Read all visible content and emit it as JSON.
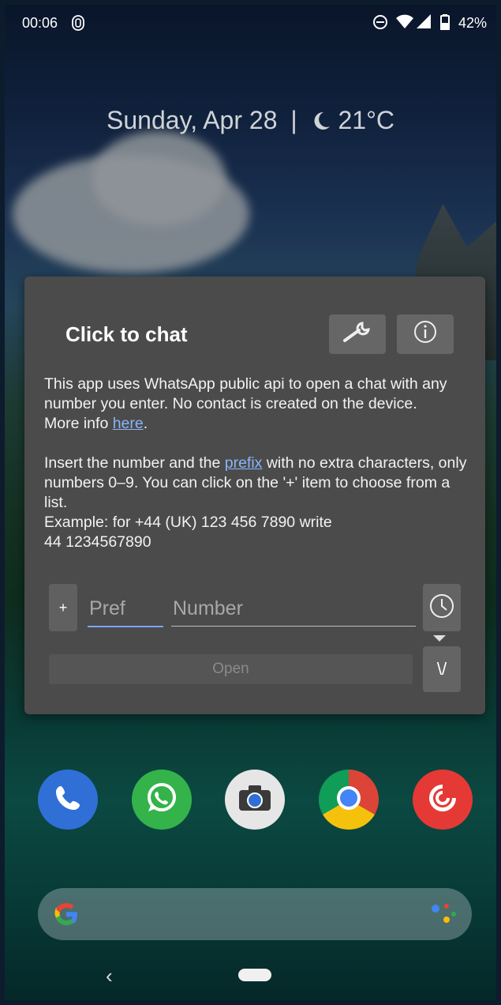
{
  "statusbar": {
    "time": "00:06",
    "battery": "42%",
    "icons": [
      "fingerprint-icon",
      "dnd-icon",
      "wifi-icon",
      "signal-icon",
      "battery-icon"
    ]
  },
  "glance": {
    "date": "Sunday, Apr 28",
    "separator": "|",
    "temperature": "21°C",
    "weather_icon": "moon-icon"
  },
  "dialog": {
    "title": "Click to chat",
    "settings_icon": "wrench-icon",
    "info_icon": "info-icon",
    "description_1": "This app uses WhatsApp public api to open a chat with any number you enter. No contact is created on the device.",
    "more_info_prefix": "More info ",
    "more_info_link": "here",
    "more_info_suffix": ".",
    "instructions_1": "Insert the number and the ",
    "prefix_link": "prefix",
    "instructions_2": " with no extra characters, only numbers 0–9. You can click on the '+' item to choose from a list.",
    "example_1": "Example: for +44 (UK) 123 456 7890 write",
    "example_2": "44 1234567890",
    "plus_label": "+",
    "prefix_placeholder": "Pref",
    "number_placeholder": "Number",
    "history_icon": "clock-icon",
    "open_label": "Open",
    "menu_label": "\\/"
  },
  "dock": {
    "apps": [
      "phone-icon",
      "whatsapp-icon",
      "camera-icon",
      "chrome-icon",
      "pocketcasts-icon"
    ]
  },
  "searchbar": {
    "logo": "google-g-icon",
    "assistant": "assistant-icon"
  },
  "navbar": {
    "back": "‹"
  },
  "colors": {
    "dialog_bg": "#4b4b4b",
    "accent": "#7aa6ff",
    "link": "#8ab4f8"
  }
}
